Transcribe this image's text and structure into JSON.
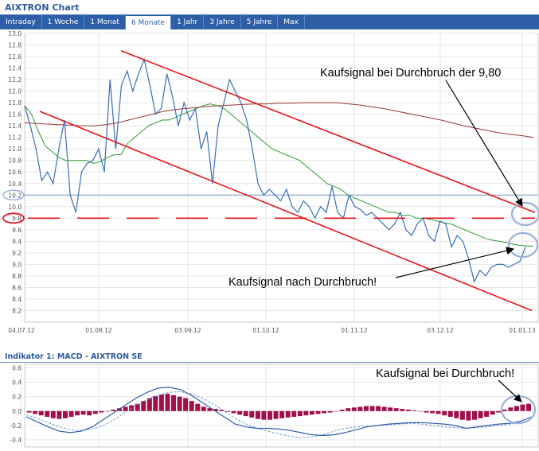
{
  "header": {
    "title": "AIXTRON Chart"
  },
  "tabs": [
    {
      "label": "Intraday",
      "active": false
    },
    {
      "label": "1 Woche",
      "active": false
    },
    {
      "label": "1 Monat",
      "active": false
    },
    {
      "label": "6 Monate",
      "active": true
    },
    {
      "label": "1 Jahr",
      "active": false
    },
    {
      "label": "3 Jahre",
      "active": false
    },
    {
      "label": "5 Jahre",
      "active": false
    },
    {
      "label": "Max",
      "active": false
    }
  ],
  "indicator": {
    "title": "Indikator 1: MACD - AIXTRON SE"
  },
  "annotations": {
    "top_right": "Kaufsignal bei Durchbruch der 9,80",
    "mid": "Kaufsignal nach Durchbruch!",
    "macd": "Kaufsignal bei Durchbruch!"
  },
  "colors": {
    "price": "#3a6fb5",
    "sma_long": "#9b3535",
    "sma_short": "#2f9a2f",
    "trend_lines": "#e8141b",
    "resistance": "#9ab2d8",
    "macd_bars": "#a0104a",
    "marker_circle": "#9ab2d8",
    "marker_circle_red": "#e8141b"
  },
  "chart_data": [
    {
      "type": "line",
      "x_ticks": [
        "04.07.12",
        "01.08.12",
        "03.09.12",
        "01.10.12",
        "01.11.12",
        "03.12.12",
        "01.01.13"
      ],
      "y_ticks": [
        8.2,
        8.4,
        8.6,
        8.8,
        9.0,
        9.2,
        9.4,
        9.6,
        9.8,
        10.0,
        10.2,
        10.4,
        10.6,
        10.8,
        11.0,
        11.2,
        11.4,
        11.6,
        11.8,
        12.0,
        12.2,
        12.4,
        12.6,
        12.8,
        13.0
      ],
      "ylim": [
        8.0,
        13.0
      ],
      "grid": true,
      "series": [
        {
          "name": "price",
          "values": [
            11.75,
            11.4,
            11.0,
            10.45,
            10.6,
            10.4,
            11.0,
            11.5,
            10.2,
            9.9,
            10.6,
            10.75,
            10.8,
            11.0,
            10.6,
            12.2,
            11.0,
            12.1,
            12.35,
            12.0,
            12.3,
            12.55,
            12.1,
            11.6,
            11.7,
            12.3,
            11.9,
            11.4,
            11.8,
            11.5,
            11.7,
            11.0,
            11.3,
            10.4,
            11.4,
            11.8,
            12.2,
            12.0,
            11.8,
            11.5,
            11.0,
            10.4,
            10.2,
            10.3,
            10.2,
            10.1,
            10.3,
            10.0,
            9.9,
            10.1,
            10.0,
            9.8,
            10.0,
            9.9,
            10.35,
            9.9,
            9.8,
            10.2,
            10.0,
            9.95,
            9.85,
            9.9,
            9.8,
            9.7,
            9.6,
            9.7,
            9.9,
            9.6,
            9.5,
            9.7,
            9.8,
            9.5,
            9.4,
            9.75,
            9.7,
            9.3,
            9.5,
            9.4,
            9.1,
            8.7,
            8.9,
            8.8,
            8.95,
            9.0,
            9.0,
            8.95,
            9.0,
            9.05,
            9.3
          ]
        },
        {
          "name": "sma_short",
          "values": [
            11.75,
            11.6,
            11.3,
            11.05,
            10.95,
            10.85,
            10.8,
            10.8,
            10.8,
            10.8,
            10.75,
            10.78,
            10.85,
            10.9,
            10.9,
            11.1,
            11.2,
            11.3,
            11.4,
            11.45,
            11.5,
            11.5,
            11.55,
            11.6,
            11.65,
            11.7,
            11.75,
            11.78,
            11.75,
            11.7,
            11.6,
            11.5,
            11.4,
            11.3,
            11.2,
            11.1,
            11.0,
            10.95,
            10.9,
            10.85,
            10.8,
            10.7,
            10.6,
            10.5,
            10.4,
            10.35,
            10.3,
            10.2,
            10.15,
            10.1,
            10.05,
            10.0,
            9.95,
            9.9,
            9.9,
            9.85,
            9.85,
            9.8,
            9.8,
            9.78,
            9.75,
            9.72,
            9.7,
            9.65,
            9.6,
            9.55,
            9.5,
            9.45,
            9.42,
            9.4,
            9.38,
            9.35,
            9.33,
            9.32,
            9.32
          ]
        },
        {
          "name": "sma_long",
          "values": [
            11.45,
            11.44,
            11.43,
            11.42,
            11.41,
            11.4,
            11.4,
            11.42,
            11.45,
            11.5,
            11.55,
            11.6,
            11.65,
            11.68,
            11.7,
            11.72,
            11.74,
            11.75,
            11.76,
            11.77,
            11.78,
            11.78,
            11.79,
            11.79,
            11.8,
            11.8,
            11.8,
            11.8,
            11.78,
            11.76,
            11.73,
            11.7,
            11.66,
            11.62,
            11.58,
            11.54,
            11.5,
            11.45,
            11.4,
            11.36,
            11.32,
            11.28,
            11.25,
            11.23,
            11.2
          ]
        },
        {
          "name": "resistance",
          "values": [
            10.2,
            10.2
          ]
        },
        {
          "name": "support_dashed",
          "values": [
            9.8,
            9.8
          ]
        },
        {
          "name": "upper_trend",
          "values": [
            12.7,
            9.9
          ]
        },
        {
          "name": "lower_trend",
          "values": [
            11.65,
            8.2
          ]
        }
      ]
    },
    {
      "type": "bar",
      "title": "Indikator 1: MACD - AIXTRON SE",
      "y_ticks": [
        0.6,
        0.4,
        0.2,
        0.0,
        -0.2,
        -0.4
      ],
      "ylim": [
        -0.5,
        0.65
      ],
      "grid": true,
      "series": [
        {
          "name": "histogram",
          "values": [
            -0.02,
            -0.04,
            -0.06,
            -0.08,
            -0.1,
            -0.11,
            -0.1,
            -0.08,
            -0.06,
            -0.05,
            -0.06,
            -0.04,
            -0.02,
            0.0,
            0.02,
            0.04,
            0.06,
            0.08,
            0.1,
            0.14,
            0.18,
            0.21,
            0.23,
            0.24,
            0.22,
            0.2,
            0.18,
            0.14,
            0.1,
            0.06,
            0.04,
            0.03,
            0.02,
            -0.01,
            -0.03,
            -0.05,
            -0.07,
            -0.09,
            -0.11,
            -0.12,
            -0.12,
            -0.11,
            -0.1,
            -0.09,
            -0.08,
            -0.07,
            -0.06,
            -0.05,
            -0.04,
            -0.03,
            -0.02,
            0.0,
            0.02,
            0.04,
            0.05,
            0.06,
            0.07,
            0.07,
            0.07,
            0.06,
            0.05,
            0.04,
            0.03,
            0.02,
            0.01,
            0.0,
            -0.02,
            -0.03,
            -0.04,
            -0.06,
            -0.08,
            -0.1,
            -0.12,
            -0.13,
            -0.12,
            -0.1,
            -0.08,
            -0.05,
            -0.02,
            0.02,
            0.05,
            0.07,
            0.09,
            0.1
          ]
        },
        {
          "name": "macd",
          "values": [
            -0.08,
            -0.15,
            -0.22,
            -0.28,
            -0.3,
            -0.28,
            -0.22,
            -0.12,
            -0.02,
            0.08,
            0.18,
            0.26,
            0.32,
            0.33,
            0.3,
            0.22,
            0.12,
            0.02,
            -0.08,
            -0.18,
            -0.22,
            -0.24,
            -0.24,
            -0.25,
            -0.27,
            -0.3,
            -0.33,
            -0.34,
            -0.33,
            -0.3,
            -0.26,
            -0.22,
            -0.2,
            -0.18,
            -0.17,
            -0.16,
            -0.16,
            -0.17,
            -0.18,
            -0.2,
            -0.24,
            -0.22,
            -0.2,
            -0.18,
            -0.17,
            -0.14,
            -0.08
          ]
        },
        {
          "name": "signal",
          "values": [
            -0.05,
            -0.1,
            -0.16,
            -0.22,
            -0.26,
            -0.27,
            -0.25,
            -0.2,
            -0.12,
            -0.02,
            0.08,
            0.16,
            0.22,
            0.26,
            0.27,
            0.24,
            0.18,
            0.1,
            0.0,
            -0.1,
            -0.18,
            -0.24,
            -0.28,
            -0.32,
            -0.35,
            -0.37,
            -0.36,
            -0.33,
            -0.28,
            -0.24,
            -0.22,
            -0.21,
            -0.2,
            -0.19,
            -0.18,
            -0.17,
            -0.18,
            -0.2,
            -0.22,
            -0.23,
            -0.24,
            -0.23,
            -0.22,
            -0.2,
            -0.18,
            -0.16,
            -0.12
          ]
        }
      ]
    }
  ]
}
